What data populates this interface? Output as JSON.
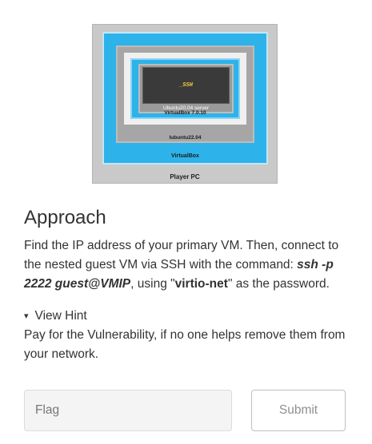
{
  "diagram": {
    "ssh_label": "_SSH",
    "ubuntu_label": "Ubuntu20.04 server",
    "virtualbox7_label": "VirtualBox 7.0.10",
    "lubuntu_label": "lubuntu22.04",
    "virtualbox_label": "VirtualBox",
    "player_label": "Player PC"
  },
  "section": {
    "title": "Approach",
    "text_before": "Find the IP address of your primary VM. Then, connect to the nested guest VM via SSH with the command: ",
    "command": "ssh -p 2222 guest@VMIP",
    "text_middle": ", using \"",
    "password": "virtio-net",
    "text_after": "\" as the password."
  },
  "hint": {
    "toggle_icon": "▾",
    "toggle_label": "View Hint",
    "text": "Pay for the Vulnerability, if no one helps remove them from your network."
  },
  "form": {
    "flag_placeholder": "Flag",
    "flag_value": "",
    "submit_label": "Submit"
  }
}
